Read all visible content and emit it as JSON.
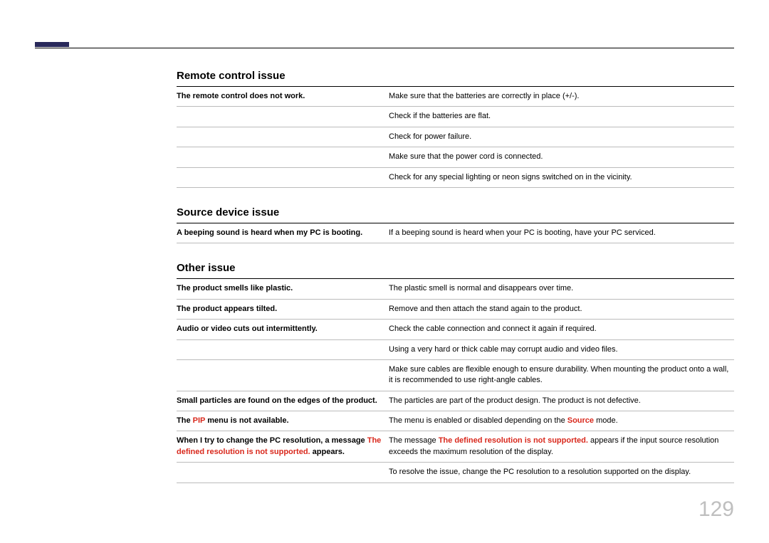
{
  "pageNumber": "129",
  "sections": {
    "remote": {
      "heading": "Remote control issue",
      "rows": [
        {
          "label": "The remote control does not work.",
          "value": "Make sure that the batteries are correctly in place (+/-)."
        },
        {
          "label": "",
          "value": "Check if the batteries are flat."
        },
        {
          "label": "",
          "value": "Check for power failure."
        },
        {
          "label": "",
          "value": "Make sure that the power cord is connected."
        },
        {
          "label": "",
          "value": "Check for any special lighting or neon signs switched on in the vicinity."
        }
      ]
    },
    "source": {
      "heading": "Source device issue",
      "rows": [
        {
          "label": "A beeping sound is heard when my PC is booting.",
          "value": "If a beeping sound is heard when your PC is booting, have your PC serviced."
        }
      ]
    },
    "other": {
      "heading": "Other issue",
      "rows": {
        "plastic_label": "The product smells like plastic.",
        "plastic_value": "The plastic smell is normal and disappears over time.",
        "tilted_label": "The product appears tilted.",
        "tilted_value": "Remove and then attach the stand again to the product.",
        "audio_label": "Audio or video cuts out intermittently.",
        "audio_v1": "Check the cable connection and connect it again if required.",
        "audio_v2": "Using a very hard or thick cable may corrupt audio and video files.",
        "audio_v3": "Make sure cables are flexible enough to ensure durability. When mounting the product onto a wall, it is recommended to use right-angle cables.",
        "particles_label": "Small particles are found on the edges of the product.",
        "particles_value": "The particles are part of the product design. The product is not defective.",
        "pip_label_pre": "The ",
        "pip_label_red": "PIP",
        "pip_label_post": " menu is not available.",
        "pip_value_pre": "The menu is enabled or disabled depending on the ",
        "pip_value_red": "Source",
        "pip_value_post": " mode.",
        "res_label_pre": "When I try to change the PC resolution, a message ",
        "res_label_red": "The defined resolution is not supported.",
        "res_label_post": " appears.",
        "res_v1_pre": "The message ",
        "res_v1_red": "The defined resolution is not supported.",
        "res_v1_post": " appears if the input source resolution exceeds the maximum resolution of the display.",
        "res_v2": "To resolve the issue, change the PC resolution to a resolution supported on the display."
      }
    }
  }
}
